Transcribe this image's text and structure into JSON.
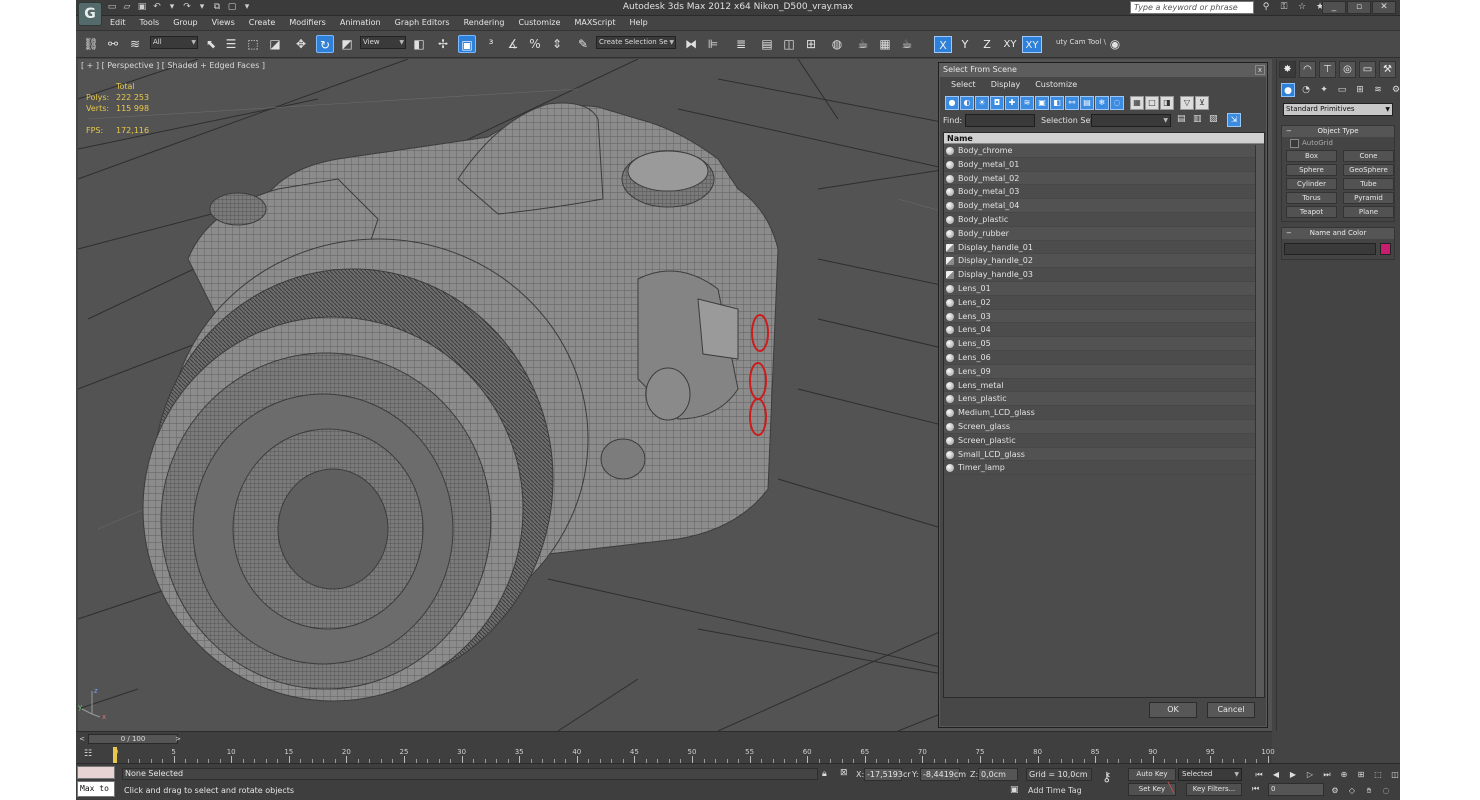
{
  "window": {
    "title": "Autodesk 3ds Max  2012 x64      Nikon_D500_vray.max",
    "search_placeholder": "Type a keyword or phrase",
    "app_logo": "G"
  },
  "menu": [
    "Edit",
    "Tools",
    "Group",
    "Views",
    "Create",
    "Modifiers",
    "Animation",
    "Graph Editors",
    "Rendering",
    "Customize",
    "MAXScript",
    "Help"
  ],
  "toolbar": {
    "filter_value": "All",
    "refcoord_value": "View",
    "selection_set_value": "Create Selection Se",
    "axis_x": "X",
    "axis_y": "Y",
    "axis_z": "Z",
    "axis_xy": "XY",
    "axis_xy2": "XY",
    "cam_tool": "uty Cam Tool \\"
  },
  "viewport": {
    "label": "[ + ] [ Perspective ] [ Shaded + Edged Faces ]",
    "stats": {
      "total_label": "Total",
      "polys_label": "Polys:",
      "polys_value": "222 253",
      "verts_label": "Verts:",
      "verts_value": "115 998",
      "fps_label": "FPS:",
      "fps_value": "172,116"
    }
  },
  "dialog": {
    "title": "Select From Scene",
    "close": "x",
    "menu": [
      "Select",
      "Display",
      "Customize"
    ],
    "find_label": "Find:",
    "selection_set_label": "Selection Set:",
    "column_name": "Name",
    "objects": [
      {
        "name": "Body_chrome",
        "kind": "object"
      },
      {
        "name": "Body_metal_01",
        "kind": "object"
      },
      {
        "name": "Body_metal_02",
        "kind": "object"
      },
      {
        "name": "Body_metal_03",
        "kind": "object"
      },
      {
        "name": "Body_metal_04",
        "kind": "object"
      },
      {
        "name": "Body_plastic",
        "kind": "object"
      },
      {
        "name": "Body_rubber",
        "kind": "object"
      },
      {
        "name": "Display_handle_01",
        "kind": "group"
      },
      {
        "name": "Display_handle_02",
        "kind": "group"
      },
      {
        "name": "Display_handle_03",
        "kind": "group"
      },
      {
        "name": "Lens_01",
        "kind": "object"
      },
      {
        "name": "Lens_02",
        "kind": "object"
      },
      {
        "name": "Lens_03",
        "kind": "object"
      },
      {
        "name": "Lens_04",
        "kind": "object"
      },
      {
        "name": "Lens_05",
        "kind": "object"
      },
      {
        "name": "Lens_06",
        "kind": "object"
      },
      {
        "name": "Lens_09",
        "kind": "object"
      },
      {
        "name": "Lens_metal",
        "kind": "object"
      },
      {
        "name": "Lens_plastic",
        "kind": "object"
      },
      {
        "name": "Medium_LCD_glass",
        "kind": "object"
      },
      {
        "name": "Screen_glass",
        "kind": "object"
      },
      {
        "name": "Screen_plastic",
        "kind": "object"
      },
      {
        "name": "Small_LCD_glass",
        "kind": "object"
      },
      {
        "name": "Timer_lamp",
        "kind": "object"
      }
    ],
    "ok": "OK",
    "cancel": "Cancel"
  },
  "command_panel": {
    "category": "Standard Primitives",
    "object_type_title": "Object Type",
    "autogrid": "AutoGrid",
    "primitives": [
      "Box",
      "Cone",
      "Sphere",
      "GeoSphere",
      "Cylinder",
      "Tube",
      "Torus",
      "Pyramid",
      "Teapot",
      "Plane"
    ],
    "name_color_title": "Name and Color",
    "object_color": "#c81c6e"
  },
  "timeline": {
    "slider_text": "0 / 100",
    "ticks": [
      "0",
      "5",
      "10",
      "15",
      "20",
      "25",
      "30",
      "35",
      "40",
      "45",
      "50",
      "55",
      "60",
      "65",
      "70",
      "75",
      "80",
      "85",
      "90",
      "95",
      "100"
    ]
  },
  "status": {
    "selection": "None Selected",
    "prompt": "Click and drag to select and rotate objects",
    "maxscript": "Max to",
    "x_label": "X:",
    "x_value": "-17,5193cr",
    "y_label": "Y:",
    "y_value": "-8,4419cm",
    "z_label": "Z:",
    "z_value": "0,0cm",
    "grid": "Grid = 10,0cm",
    "add_time_tag": "Add Time Tag",
    "auto_key": "Auto Key",
    "set_key": "Set Key",
    "selected": "Selected",
    "key_filters": "Key Filters...",
    "frame": "0"
  }
}
